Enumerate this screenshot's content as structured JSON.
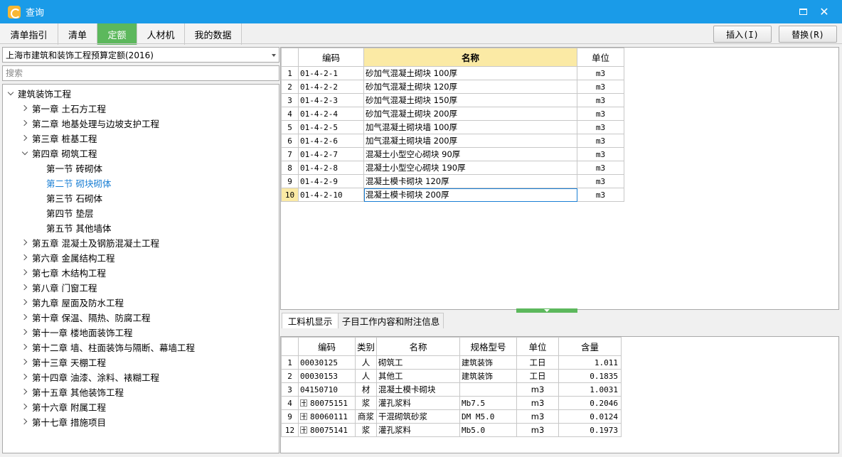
{
  "window": {
    "title": "查询"
  },
  "tabs": [
    {
      "label": "清单指引",
      "active": false
    },
    {
      "label": "清单",
      "active": false
    },
    {
      "label": "定额",
      "active": true
    },
    {
      "label": "人材机",
      "active": false
    },
    {
      "label": "我的数据",
      "active": false
    }
  ],
  "buttons": {
    "insert": "插入(I)",
    "replace": "替换(R)"
  },
  "library": {
    "selected": "上海市建筑和装饰工程预算定额(2016)"
  },
  "search": {
    "placeholder": "搜索",
    "value": ""
  },
  "tree": [
    {
      "label": "建筑装饰工程",
      "level": 0,
      "expanded": true
    },
    {
      "label": "第一章  土石方工程",
      "level": 1,
      "expanded": false
    },
    {
      "label": "第二章  地基处理与边坡支护工程",
      "level": 1,
      "expanded": false
    },
    {
      "label": "第三章  桩基工程",
      "level": 1,
      "expanded": false
    },
    {
      "label": "第四章  砌筑工程",
      "level": 1,
      "expanded": true
    },
    {
      "label": "第一节  砖砌体",
      "level": 2
    },
    {
      "label": "第二节  砌块砌体",
      "level": 2,
      "selected": true
    },
    {
      "label": "第三节  石砌体",
      "level": 2
    },
    {
      "label": "第四节  垫层",
      "level": 2
    },
    {
      "label": "第五节  其他墙体",
      "level": 2
    },
    {
      "label": "第五章  混凝土及钢筋混凝土工程",
      "level": 1,
      "expanded": false
    },
    {
      "label": "第六章  金属结构工程",
      "level": 1,
      "expanded": false
    },
    {
      "label": "第七章  木结构工程",
      "level": 1,
      "expanded": false
    },
    {
      "label": "第八章  门窗工程",
      "level": 1,
      "expanded": false
    },
    {
      "label": "第九章  屋面及防水工程",
      "level": 1,
      "expanded": false
    },
    {
      "label": "第十章  保温、隔热、防腐工程",
      "level": 1,
      "expanded": false
    },
    {
      "label": "第十一章  楼地面装饰工程",
      "level": 1,
      "expanded": false
    },
    {
      "label": "第十二章  墙、柱面装饰与隔断、幕墙工程",
      "level": 1,
      "expanded": false
    },
    {
      "label": "第十三章  天棚工程",
      "level": 1,
      "expanded": false
    },
    {
      "label": "第十四章  油漆、涂料、裱糊工程",
      "level": 1,
      "expanded": false
    },
    {
      "label": "第十五章  其他装饰工程",
      "level": 1,
      "expanded": false
    },
    {
      "label": "第十六章  附属工程",
      "level": 1,
      "expanded": false
    },
    {
      "label": "第十七章  措施项目",
      "level": 1,
      "expanded": false
    }
  ],
  "quota_table": {
    "headers": [
      "",
      "编码",
      "名称",
      "单位"
    ],
    "rows": [
      {
        "no": "1",
        "code": "01-4-2-1",
        "name": "砂加气混凝土砌块 100厚",
        "unit": "m3"
      },
      {
        "no": "2",
        "code": "01-4-2-2",
        "name": "砂加气混凝土砌块 120厚",
        "unit": "m3"
      },
      {
        "no": "3",
        "code": "01-4-2-3",
        "name": "砂加气混凝土砌块 150厚",
        "unit": "m3"
      },
      {
        "no": "4",
        "code": "01-4-2-4",
        "name": "砂加气混凝土砌块 200厚",
        "unit": "m3"
      },
      {
        "no": "5",
        "code": "01-4-2-5",
        "name": "加气混凝土砌块墙 100厚",
        "unit": "m3"
      },
      {
        "no": "6",
        "code": "01-4-2-6",
        "name": "加气混凝土砌块墙 200厚",
        "unit": "m3"
      },
      {
        "no": "7",
        "code": "01-4-2-7",
        "name": "混凝土小型空心砌块 90厚",
        "unit": "m3"
      },
      {
        "no": "8",
        "code": "01-4-2-8",
        "name": "混凝土小型空心砌块 190厚",
        "unit": "m3"
      },
      {
        "no": "9",
        "code": "01-4-2-9",
        "name": "混凝土模卡砌块 120厚",
        "unit": "m3"
      },
      {
        "no": "10",
        "code": "01-4-2-10",
        "name": "混凝土模卡砌块 200厚",
        "unit": "m3",
        "selected": true
      }
    ]
  },
  "bottom_tabs": [
    {
      "label": "工料机显示",
      "active": true
    },
    {
      "label": "子目工作内容和附注信息",
      "active": false
    }
  ],
  "material_table": {
    "headers": [
      "",
      "编码",
      "类别",
      "名称",
      "规格型号",
      "单位",
      "含量"
    ],
    "rows": [
      {
        "no": "1",
        "expand": false,
        "code": "00030125",
        "type": "人",
        "name": "砌筑工",
        "spec": "建筑装饰",
        "unit": "工日",
        "qty": "1.011"
      },
      {
        "no": "2",
        "expand": false,
        "code": "00030153",
        "type": "人",
        "name": "其他工",
        "spec": "建筑装饰",
        "unit": "工日",
        "qty": "0.1835"
      },
      {
        "no": "3",
        "expand": false,
        "code": "04150710",
        "type": "材",
        "name": "混凝土模卡砌块",
        "spec": "",
        "unit": "m3",
        "qty": "1.0031"
      },
      {
        "no": "4",
        "expand": true,
        "code": "80075151",
        "type": "浆",
        "name": "灌孔浆料",
        "spec": "Mb7.5",
        "unit": "m3",
        "qty": "0.2046"
      },
      {
        "no": "9",
        "expand": true,
        "code": "80060111",
        "type": "商浆",
        "name": "干混砌筑砂浆",
        "spec": "DM M5.0",
        "unit": "m3",
        "qty": "0.0124"
      },
      {
        "no": "12",
        "expand": true,
        "code": "80075141",
        "type": "浆",
        "name": "灌孔浆料",
        "spec": "Mb5.0",
        "unit": "m3",
        "qty": "0.1973"
      }
    ]
  },
  "colors": {
    "titlebar": "#1a9be8",
    "active_tab": "#5cb85c",
    "selection": "#fbeaa5",
    "tree_selected": "#1a7fd4"
  }
}
